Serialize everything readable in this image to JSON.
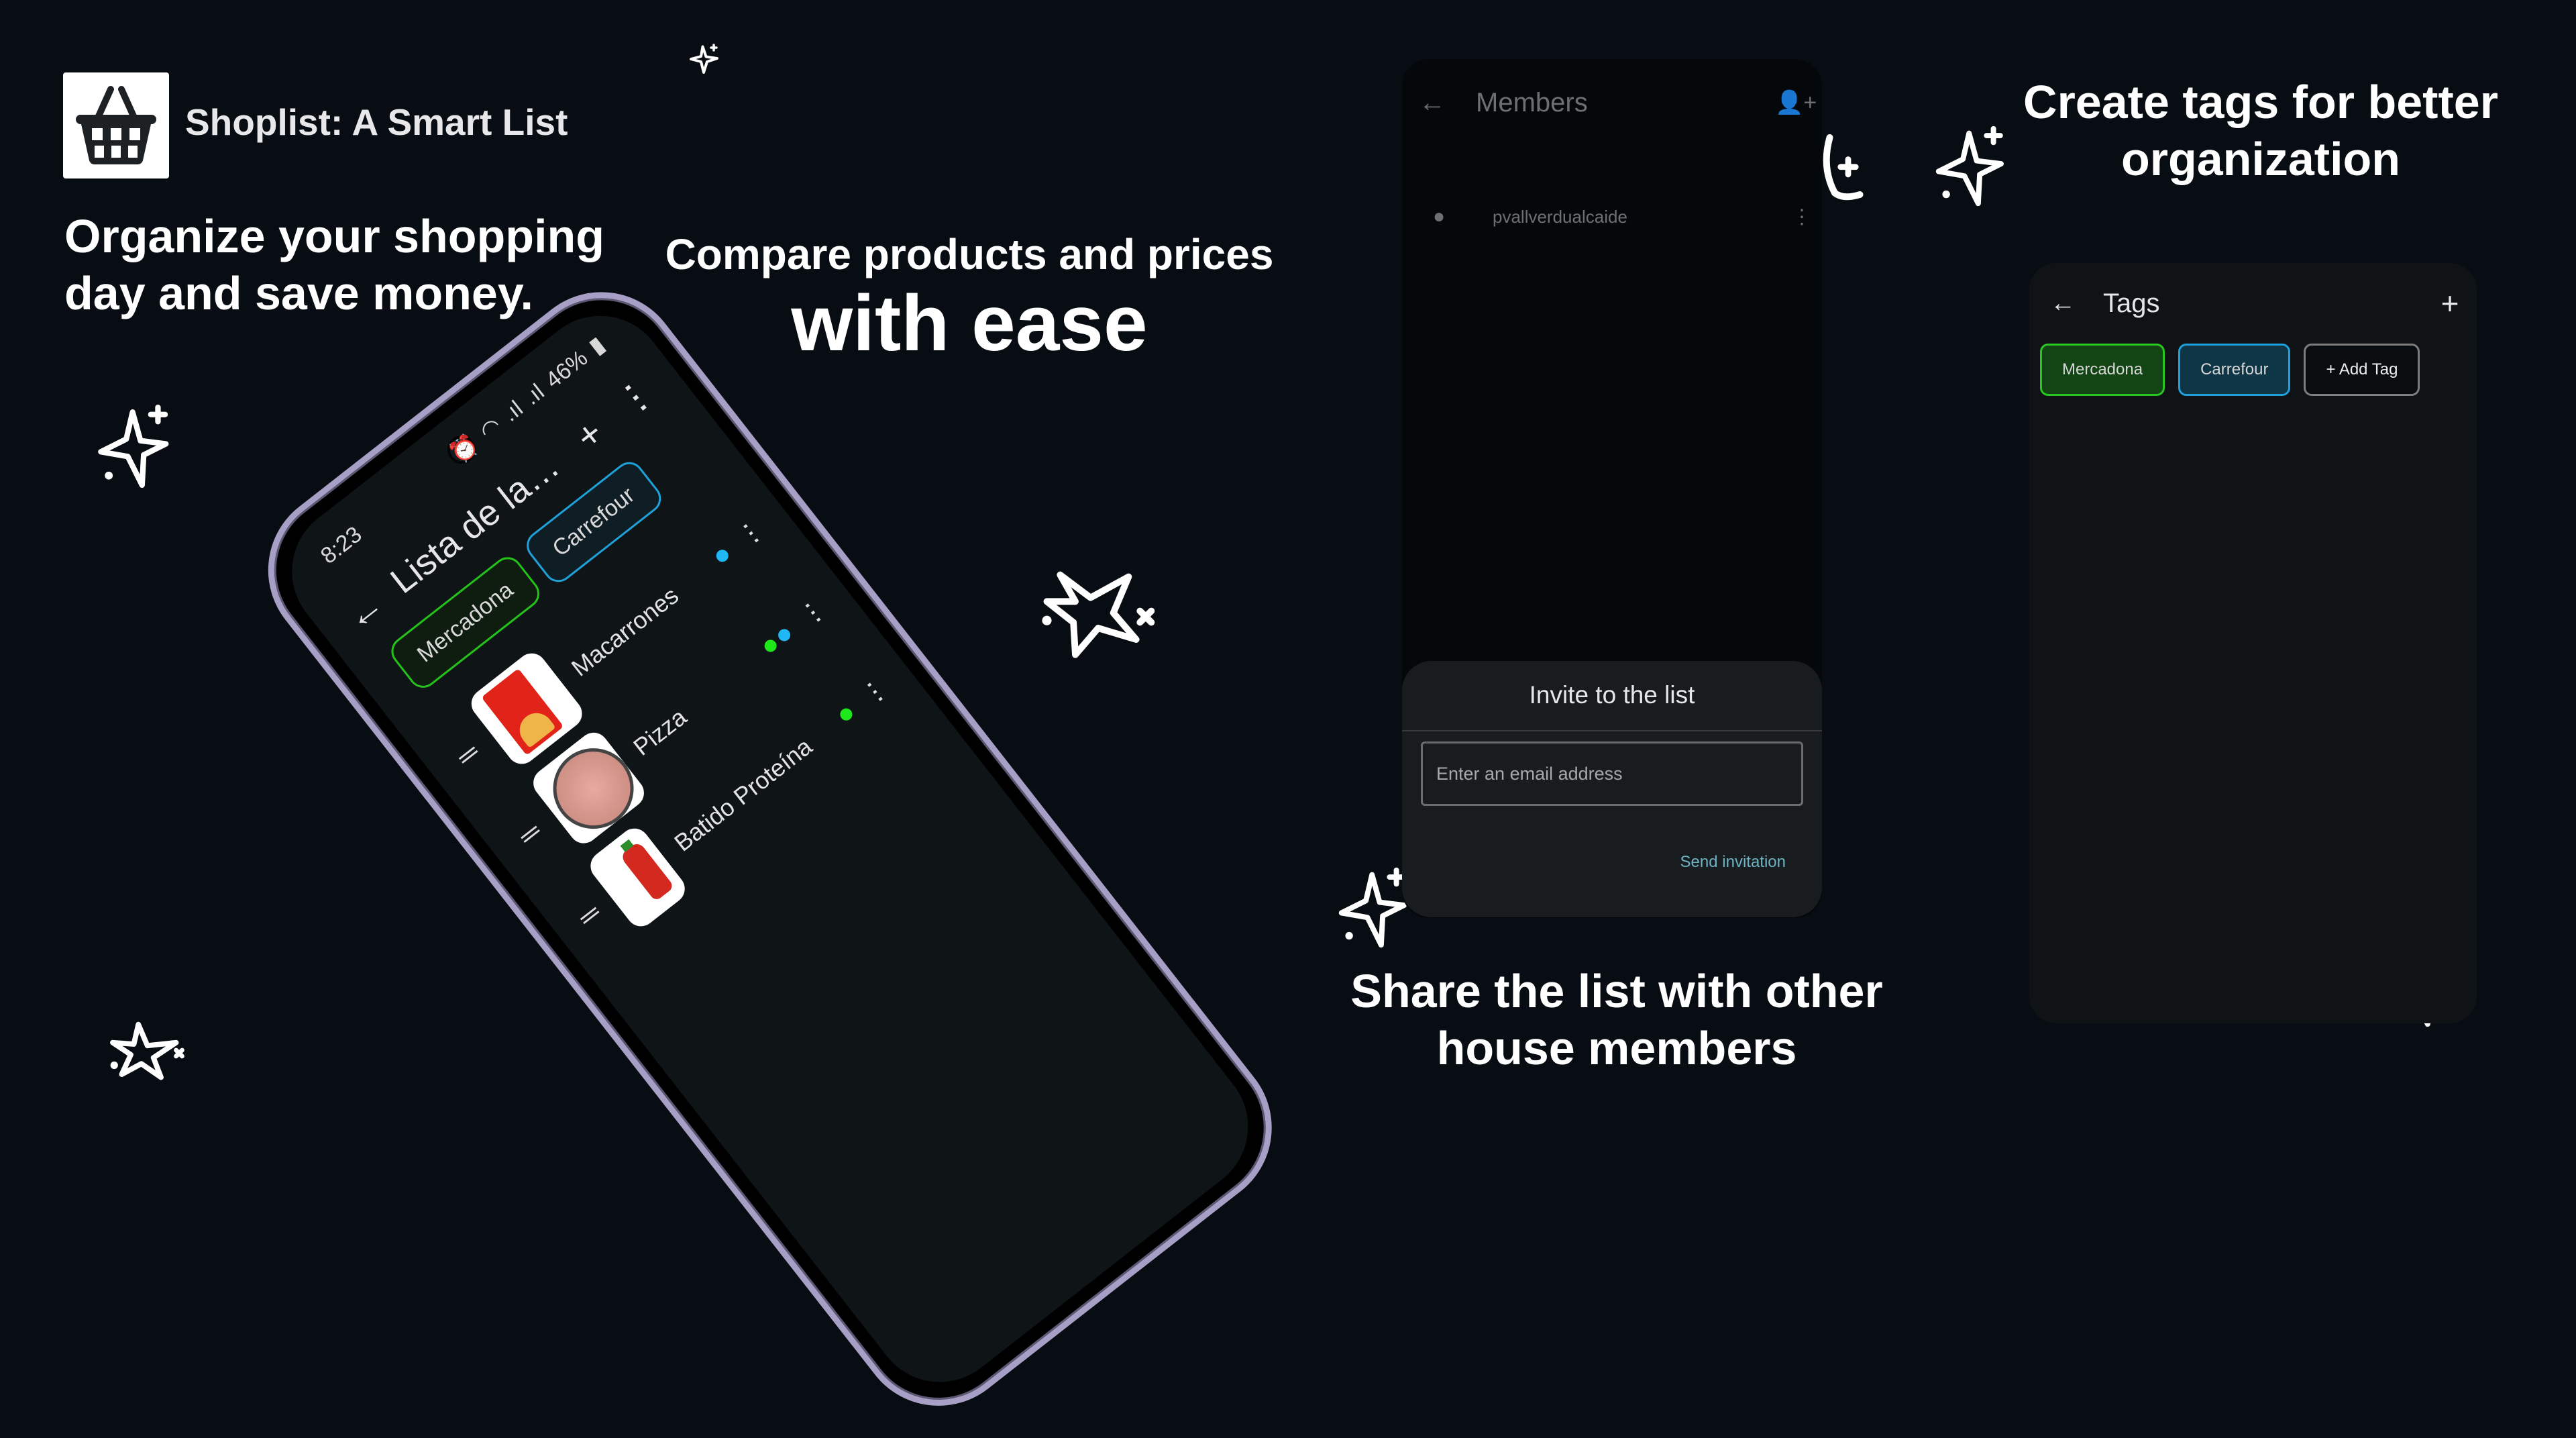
{
  "brand": {
    "app_title": "Shoplist: A Smart List",
    "logo_icon": "shopping-basket-icon"
  },
  "headlines": {
    "organize": "Organize your shopping day and save money.",
    "compare_line1": "Compare products and prices",
    "compare_line2": "with ease",
    "tags": "Create tags for better organization",
    "share": "Share the list with other house members"
  },
  "phone": {
    "status": {
      "time": "8:23",
      "battery": "46%",
      "icons": [
        "alarm-icon",
        "wifi-icon",
        "call-icon",
        "signal-icon",
        "signal-icon",
        "battery-icon"
      ]
    },
    "app_bar": {
      "back_icon": "arrow-left-icon",
      "title": "Lista de la comp...",
      "add_icon": "plus-icon",
      "menu_icon": "more-vertical-icon"
    },
    "tags": [
      {
        "label": "Mercadona",
        "color": "#25c21b"
      },
      {
        "label": "Carrefour",
        "color": "#1fa1da"
      }
    ],
    "items": [
      {
        "name": "Macarrones",
        "image": "pasta-package",
        "tag_colors": [
          "#1fa1da"
        ]
      },
      {
        "name": "Pizza",
        "image": "pizza",
        "tag_colors": [
          "#1ee81a",
          "#1fb8f5"
        ]
      },
      {
        "name": "Batido Proteína",
        "image": "protein-shake-bottle",
        "tag_colors": [
          "#1ee81a"
        ]
      }
    ]
  },
  "members_screen": {
    "title": "Members",
    "back_icon": "arrow-left-icon",
    "add_member_icon": "person-add-icon",
    "members": [
      {
        "username": "pvallverdualcaide"
      }
    ]
  },
  "invite_dialog": {
    "title": "Invite to the list",
    "email_placeholder": "Enter an email address",
    "email_value": "",
    "send_label": "Send invitation"
  },
  "tags_screen": {
    "title": "Tags",
    "back_icon": "arrow-left-icon",
    "add_icon": "plus-icon",
    "tags": [
      {
        "label": "Mercadona",
        "style": "green"
      },
      {
        "label": "Carrefour",
        "style": "blue"
      }
    ],
    "add_tag_label": "+ Add Tag"
  },
  "colors": {
    "background": "#080d13",
    "mercadona_green": "#25c21b",
    "carrefour_blue": "#1fa1da",
    "send_link": "#6db3c3",
    "phone_frame": "#a79fc6"
  }
}
